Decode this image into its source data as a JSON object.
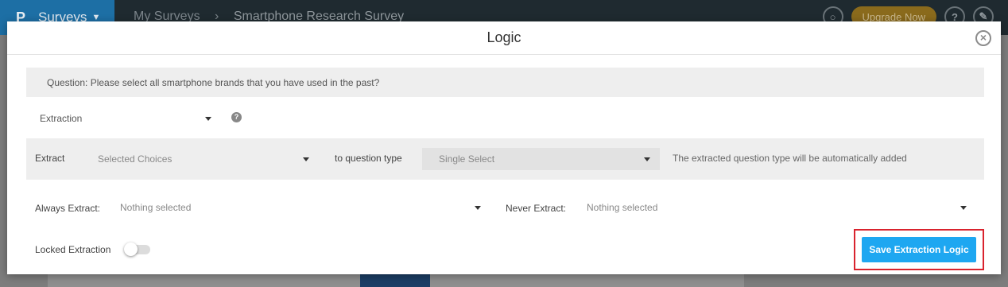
{
  "app": {
    "product_menu": "Surveys",
    "breadcrumb": [
      "My Surveys",
      "Smartphone Research Survey"
    ],
    "upgrade_label": "Upgrade Now",
    "help_label": "?"
  },
  "modal": {
    "title": "Logic",
    "question_text": "Question: Please select all smartphone brands that you have used in the past?",
    "logic_type": "Extraction",
    "extract": {
      "label": "Extract",
      "choices_value": "Selected Choices",
      "to_label": "to question type",
      "question_type_value": "Single Select",
      "note": "The extracted question type will be automatically added"
    },
    "always_extract": {
      "label": "Always Extract:",
      "placeholder": "Nothing selected"
    },
    "never_extract": {
      "label": "Never Extract:",
      "placeholder": "Nothing selected"
    },
    "locked_extraction": {
      "label": "Locked Extraction",
      "enabled": false
    },
    "save_label": "Save Extraction Logic"
  },
  "colors": {
    "accent": "#1ea7f1",
    "highlight": "#d9232e",
    "brand": "#1d6fa5"
  },
  "icons": [
    "chevron-down-icon",
    "help-icon",
    "close-icon",
    "search-icon",
    "notifications-icon"
  ]
}
